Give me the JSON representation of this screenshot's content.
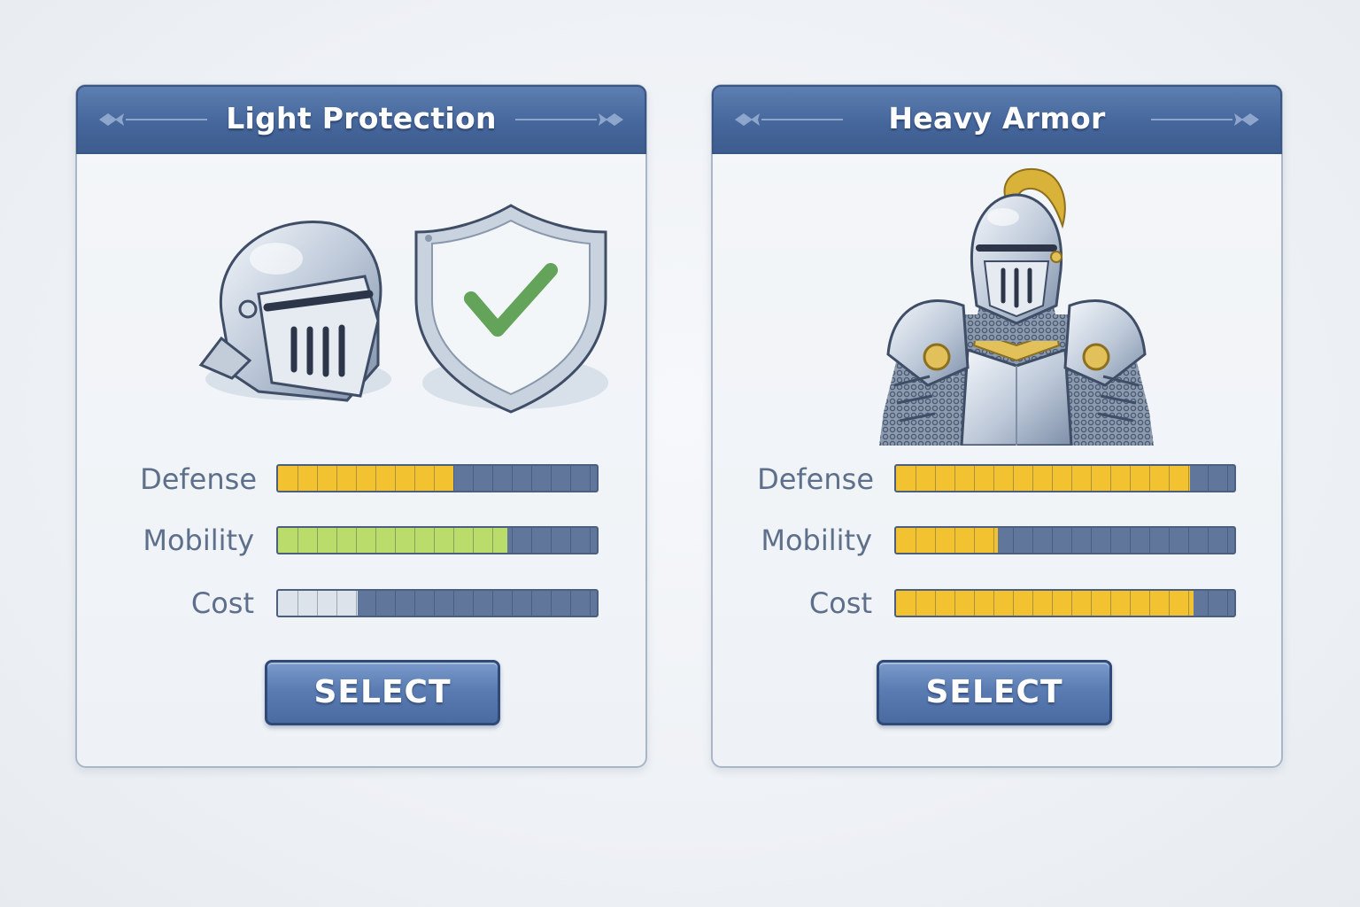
{
  "colors": {
    "header_blue": "#46679c",
    "bar_empty": "#60769a",
    "bar_gold": "#f2c230",
    "bar_green": "#b9dc6a",
    "bar_silver": "#dde3ea"
  },
  "cards": [
    {
      "title": "Light Protection",
      "icons": [
        "knight-helmet-icon",
        "shield-checkmark-icon"
      ],
      "stats": [
        {
          "label": "Defense",
          "value": 0.55,
          "color": "#f2c230"
        },
        {
          "label": "Mobility",
          "value": 0.72,
          "color": "#b9dc6a"
        },
        {
          "label": "Cost",
          "value": 0.25,
          "color": "#dde3ea"
        }
      ],
      "button_label": "SELECT"
    },
    {
      "title": "Heavy Armor",
      "icons": [
        "armored-knight-icon"
      ],
      "stats": [
        {
          "label": "Defense",
          "value": 0.87,
          "color": "#f2c230"
        },
        {
          "label": "Mobility",
          "value": 0.3,
          "color": "#f2c230"
        },
        {
          "label": "Cost",
          "value": 0.88,
          "color": "#f2c230"
        }
      ],
      "button_label": "SELECT"
    }
  ]
}
